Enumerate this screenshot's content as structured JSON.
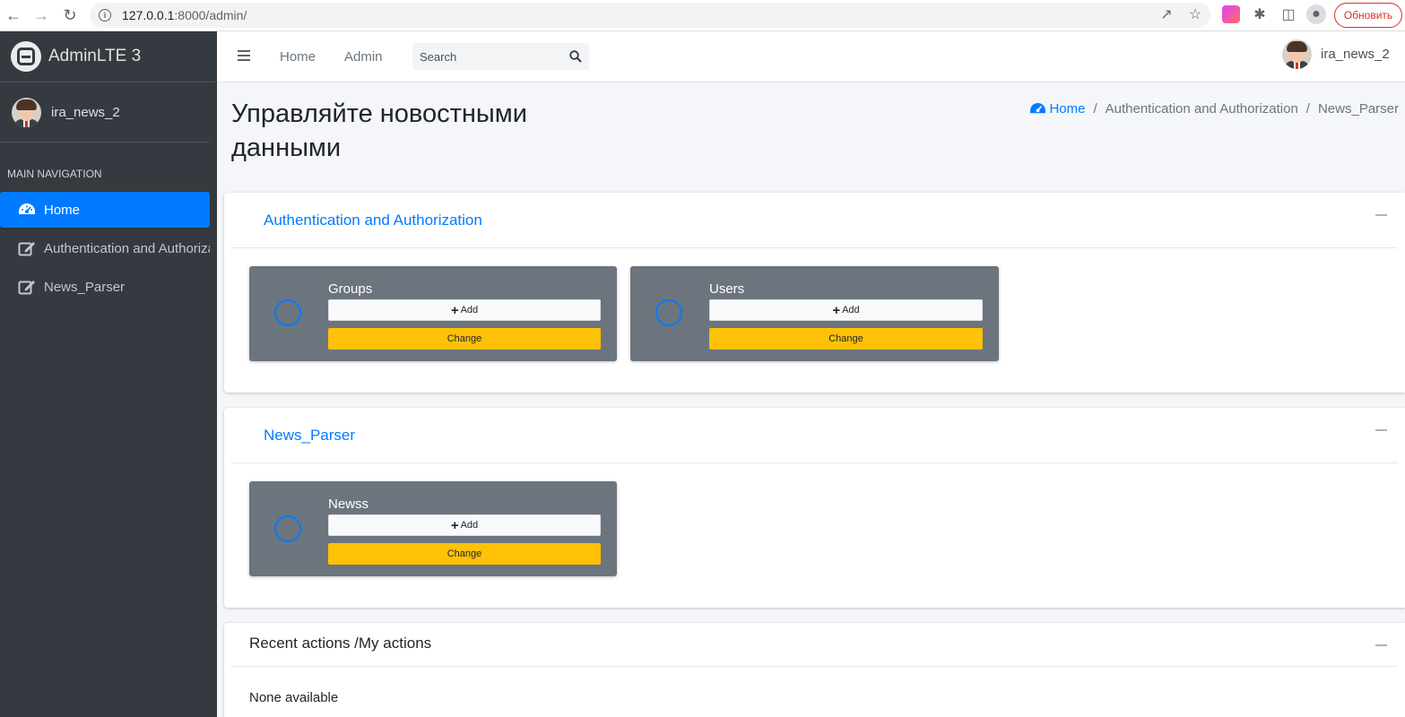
{
  "browser": {
    "url_host": "127.0.0.1",
    "url_path": ":8000/admin/",
    "update_label": "Обновить"
  },
  "sidebar": {
    "brand": "AdminLTE 3",
    "user": "ira_news_2",
    "nav_header": "MAIN NAVIGATION",
    "items": [
      {
        "label": "Home",
        "icon": "tachometer-icon",
        "active": true
      },
      {
        "label": "Authentication and Authorization",
        "icon": "edit-icon",
        "active": false
      },
      {
        "label": "News_Parser",
        "icon": "edit-icon",
        "active": false
      }
    ]
  },
  "topnav": {
    "home": "Home",
    "admin": "Admin",
    "search_placeholder": "Search",
    "user": "ira_news_2"
  },
  "header": {
    "title": "Управляйте новостными данными",
    "breadcrumb": [
      "Home",
      "Authentication and Authorization",
      "News_Parser"
    ]
  },
  "apps": [
    {
      "title": "Authentication and Authorization",
      "models": [
        {
          "name": "Groups",
          "add": "Add",
          "change": "Change"
        },
        {
          "name": "Users",
          "add": "Add",
          "change": "Change"
        }
      ]
    },
    {
      "title": "News_Parser",
      "models": [
        {
          "name": "Newss",
          "add": "Add",
          "change": "Change"
        }
      ]
    }
  ],
  "recent": {
    "title": "Recent actions /My actions",
    "empty": "None available"
  },
  "colors": {
    "primary": "#007bff",
    "warning": "#ffc107",
    "sidebar": "#343a40",
    "info_box": "#6c757d"
  }
}
